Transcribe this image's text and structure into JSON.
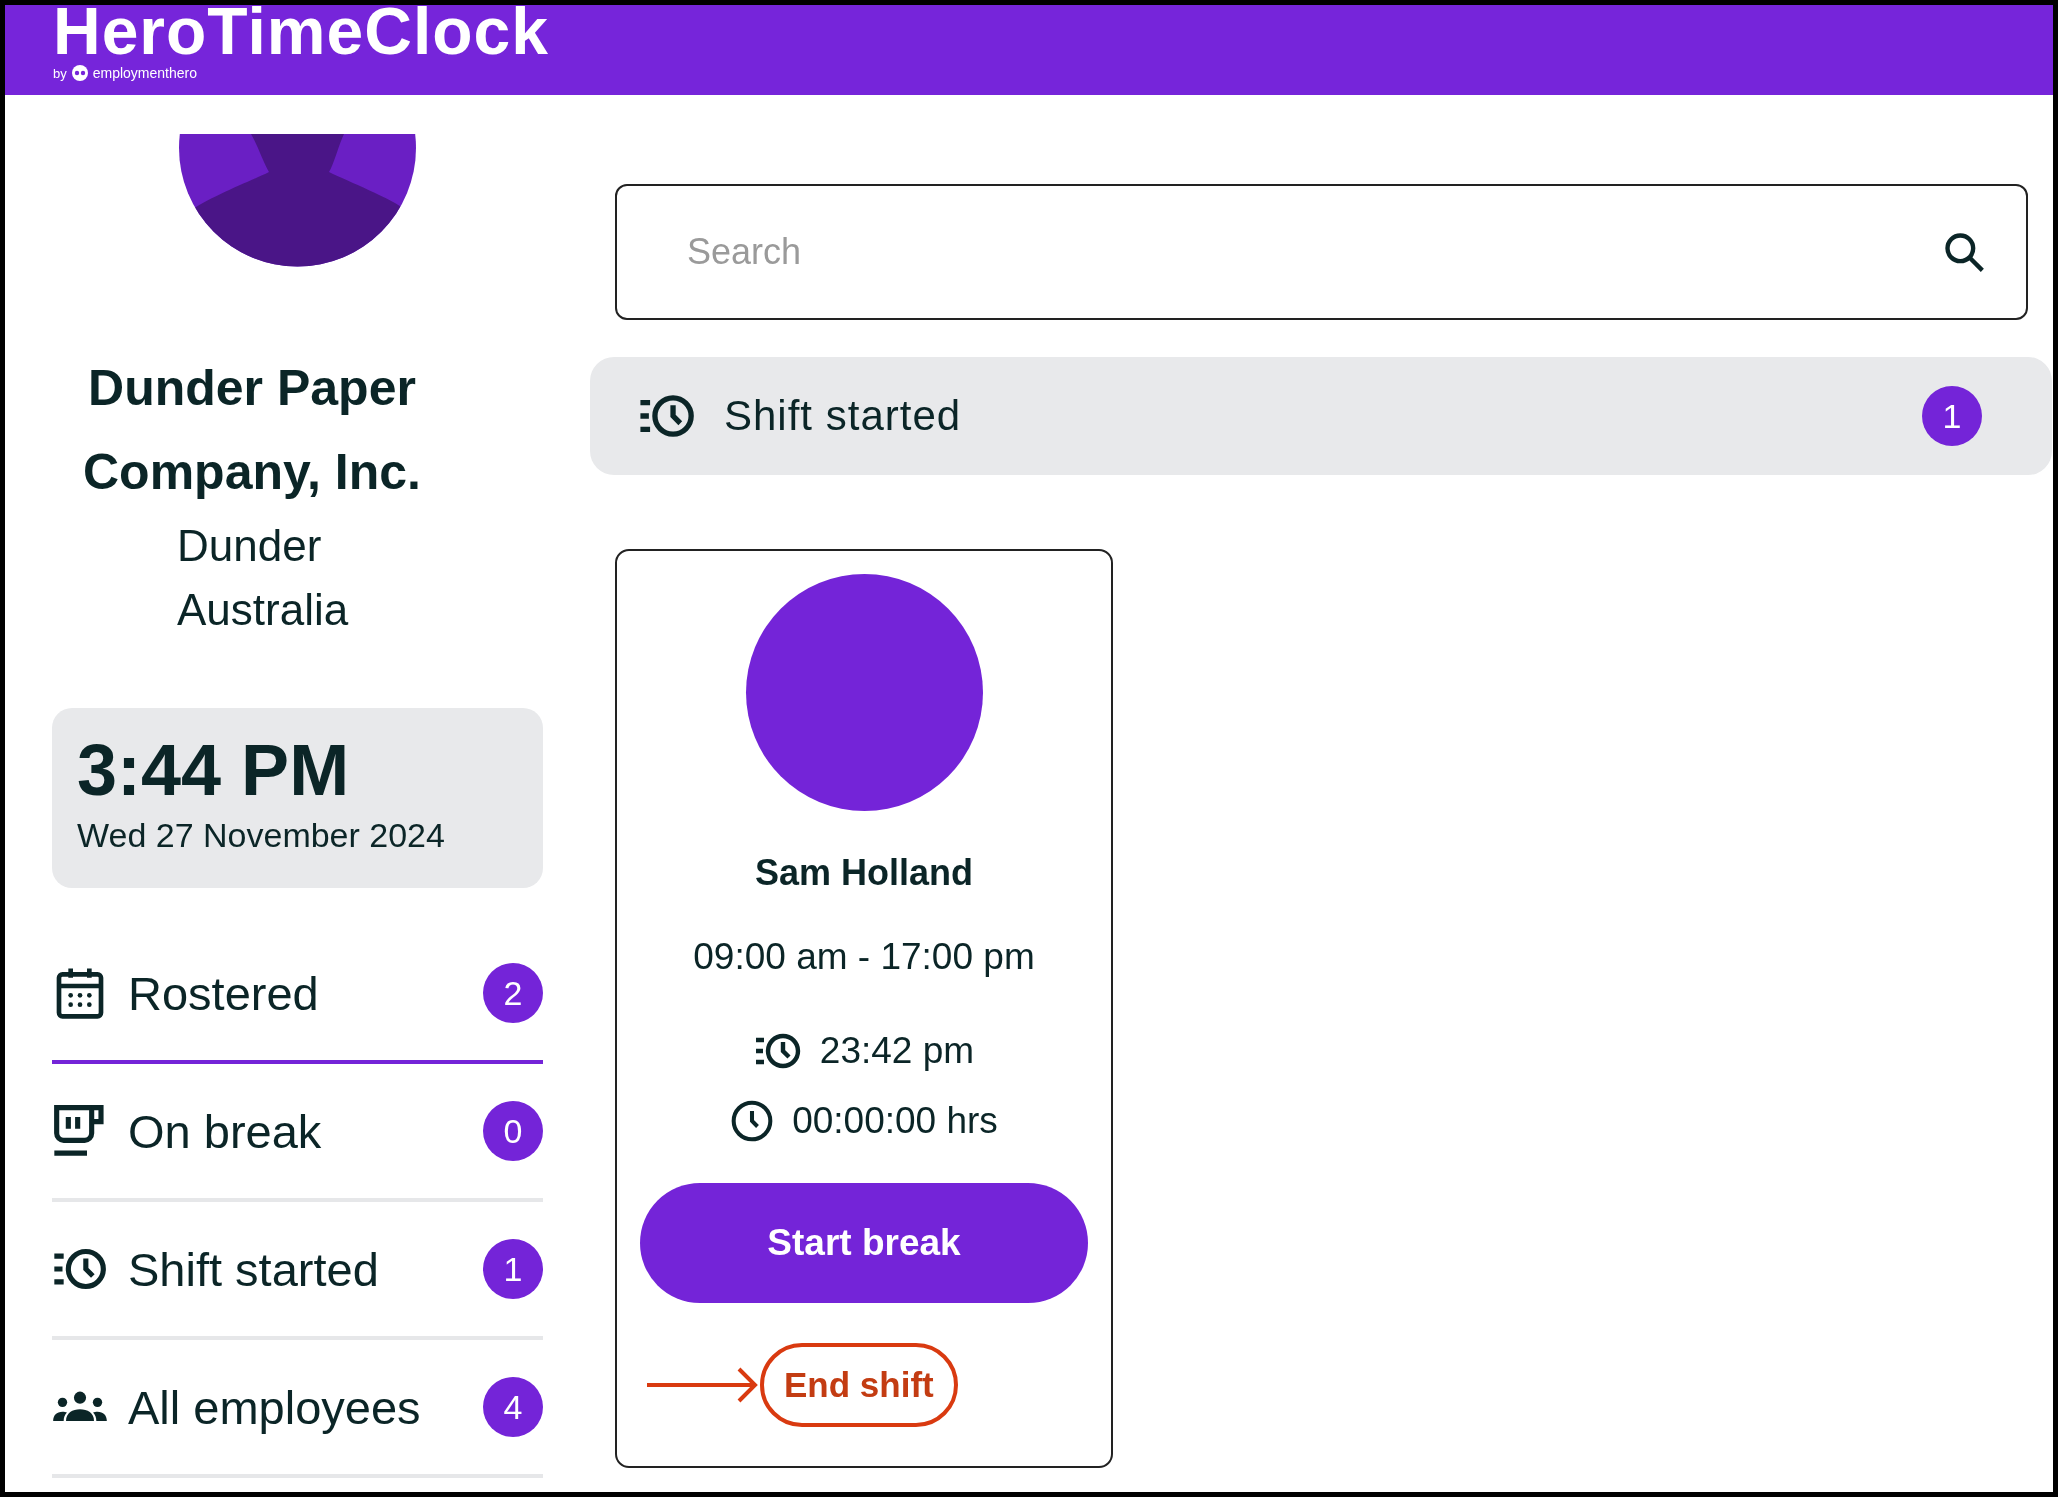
{
  "header": {
    "title": "HeroTimeClock",
    "byline_prefix": "by",
    "byline_brand": "employmenthero"
  },
  "organisation": {
    "name_lines": [
      "Dunder Paper",
      "Company, Inc."
    ],
    "location_lines": [
      "Dunder",
      "Australia"
    ]
  },
  "clock": {
    "time": "3:44 PM",
    "date": "Wed 27 November 2024"
  },
  "nav": [
    {
      "kind": "rostered",
      "label": "Rostered",
      "count": "2",
      "selected": true
    },
    {
      "kind": "on_break",
      "label": "On break",
      "count": "0",
      "selected": false
    },
    {
      "kind": "shift_started",
      "label": "Shift started",
      "count": "1",
      "selected": false
    },
    {
      "kind": "all",
      "label": "All employees",
      "count": "4",
      "selected": false
    }
  ],
  "search": {
    "placeholder": "Search"
  },
  "section": {
    "kind": "shift_started",
    "label": "Shift started",
    "count": "1"
  },
  "employees": [
    {
      "name": "Sam Holland",
      "shift_time": "09:00 am - 17:00 pm",
      "started_at": "23:42 pm",
      "duration": "00:00:00 hrs",
      "actions": [
        {
          "kind": "primary",
          "label": "Start break"
        },
        {
          "kind": "text",
          "label": "End shift",
          "highlighted": true
        }
      ]
    }
  ]
}
